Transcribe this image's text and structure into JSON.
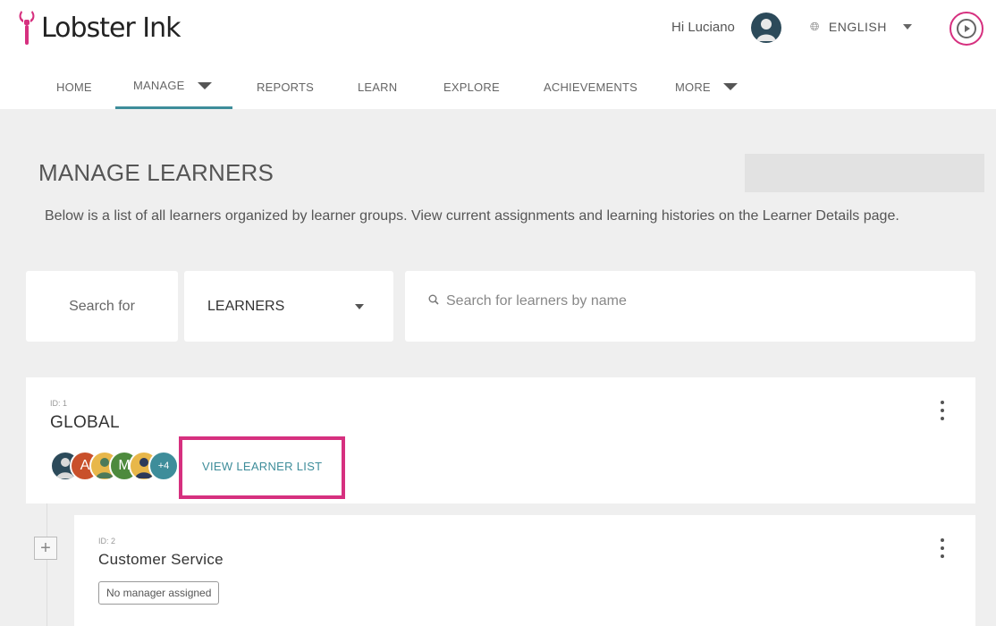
{
  "brand": {
    "name": "Lobster Ink",
    "accent": "#d6307f",
    "teal": "#3e8d9a"
  },
  "header": {
    "greeting": "Hi Luciano",
    "language": "ENGLISH",
    "icons": {
      "globe": "globe-icon",
      "play": "play-icon",
      "avatar": "user-avatar"
    }
  },
  "nav": {
    "items": [
      {
        "label": "HOME"
      },
      {
        "label": "MANAGE",
        "active": true,
        "dropdown": true
      },
      {
        "label": "REPORTS"
      },
      {
        "label": "LEARN"
      },
      {
        "label": "EXPLORE"
      },
      {
        "label": "ACHIEVEMENTS"
      },
      {
        "label": "MORE",
        "dropdown": true
      }
    ]
  },
  "main": {
    "title": "MANAGE LEARNERS",
    "description": "Below is a list of all learners organized by learner groups. View current assignments and learning histories on the Learner Details page.",
    "search": {
      "label": "Search for",
      "type_selected": "LEARNERS",
      "placeholder": "Search for learners by name"
    }
  },
  "groups": [
    {
      "id_label": "ID: 1",
      "name": "GLOBAL",
      "avatars": [
        {
          "initial": "",
          "color": "#2c4a5a"
        },
        {
          "initial": "A",
          "color": "#c9502b"
        },
        {
          "initial": "",
          "color": "#e8b74a"
        },
        {
          "initial": "M",
          "color": "#4d8a3d"
        },
        {
          "initial": "",
          "color": "#e8b74a"
        },
        {
          "initial": "+4",
          "color": "#3e8d9a"
        }
      ],
      "action": "VIEW LEARNER LIST"
    },
    {
      "id_label": "ID: 2",
      "name": "Customer Service",
      "badge": "No manager assigned",
      "expand_symbol": "+"
    }
  ]
}
